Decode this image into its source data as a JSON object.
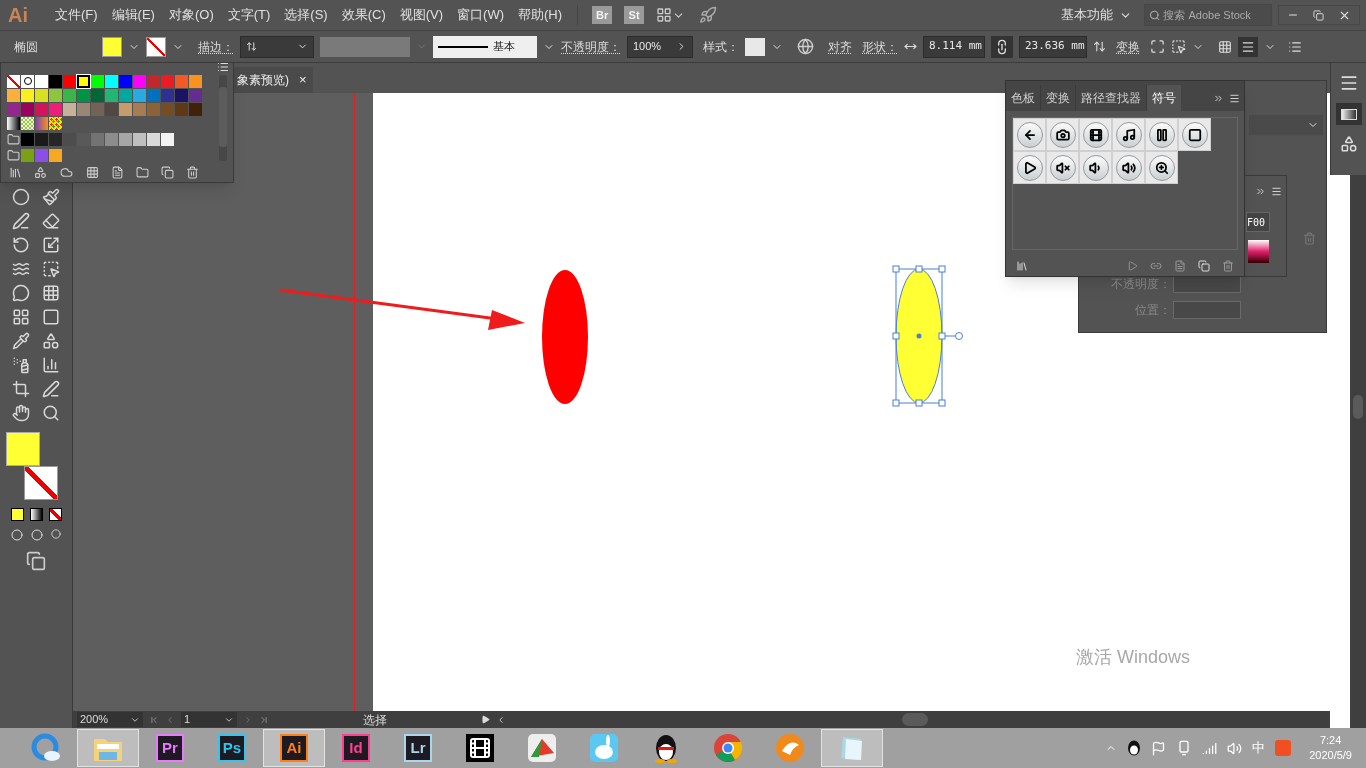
{
  "menu_bar": {
    "logo": "Ai",
    "items": [
      "文件(F)",
      "编辑(E)",
      "对象(O)",
      "文字(T)",
      "选择(S)",
      "效果(C)",
      "视图(V)",
      "窗口(W)",
      "帮助(H)"
    ],
    "bridge": "Br",
    "stock": "St",
    "workspace": "基本功能",
    "search": {
      "placeholder": "搜索 Adobe Stock"
    }
  },
  "control_bar": {
    "object_type": "椭圆",
    "fill": {
      "color": "#ffff33"
    },
    "stroke": {
      "kind": "none"
    },
    "stroke_label": "描边：",
    "profile": "基本",
    "opacity_label": "不透明度：",
    "opacity": "100%",
    "style_label": "样式：",
    "align": "对齐",
    "shape_label": "形状：",
    "width": "8.114 mm",
    "height": "23.636 mm",
    "transform": "变换"
  },
  "document_tab": {
    "title": "象素预览)",
    "close": "×"
  },
  "swatches": {
    "rows": [
      [
        {
          "kind": "none",
          "selected": false
        },
        {
          "kind": "registration",
          "selected": false
        },
        {
          "kind": "color",
          "color": "#ffffff",
          "selected": false
        },
        {
          "kind": "color",
          "color": "#000000",
          "selected": false
        },
        {
          "kind": "color",
          "color": "#ff0000",
          "selected": false
        },
        {
          "kind": "color",
          "color": "#ffff00",
          "selected": true
        },
        {
          "kind": "color",
          "color": "#00ff00",
          "selected": false
        },
        {
          "kind": "color",
          "color": "#00ffff",
          "selected": false
        },
        {
          "kind": "color",
          "color": "#0000ff",
          "selected": false
        },
        {
          "kind": "color",
          "color": "#ff00ff",
          "selected": false
        },
        {
          "kind": "color",
          "color": "#c1272d",
          "selected": false
        },
        {
          "kind": "color",
          "color": "#ed1c24",
          "selected": false
        },
        {
          "kind": "color",
          "color": "#f15a24",
          "selected": false
        },
        {
          "kind": "color",
          "color": "#f7931e",
          "selected": false
        }
      ],
      [
        {
          "kind": "color",
          "color": "#fbb03b",
          "selected": false
        },
        {
          "kind": "color",
          "color": "#fcee21",
          "selected": false
        },
        {
          "kind": "color",
          "color": "#d9e021",
          "selected": false
        },
        {
          "kind": "color",
          "color": "#8cc63f",
          "selected": false
        },
        {
          "kind": "color",
          "color": "#39b54a",
          "selected": false
        },
        {
          "kind": "color",
          "color": "#009245",
          "selected": false
        },
        {
          "kind": "color",
          "color": "#006837",
          "selected": false
        },
        {
          "kind": "color",
          "color": "#22b573",
          "selected": false
        },
        {
          "kind": "color",
          "color": "#00a99d",
          "selected": false
        },
        {
          "kind": "color",
          "color": "#29abe2",
          "selected": false
        },
        {
          "kind": "color",
          "color": "#0071bc",
          "selected": false
        },
        {
          "kind": "color",
          "color": "#2e3192",
          "selected": false
        },
        {
          "kind": "color",
          "color": "#1b1464",
          "selected": false
        },
        {
          "kind": "color",
          "color": "#662d91",
          "selected": false
        }
      ],
      [
        {
          "kind": "color",
          "color": "#93278f",
          "selected": false
        },
        {
          "kind": "color",
          "color": "#9e005d",
          "selected": false
        },
        {
          "kind": "color",
          "color": "#d4145a",
          "selected": false
        },
        {
          "kind": "color",
          "color": "#ed1e79",
          "selected": false
        },
        {
          "kind": "color",
          "color": "#c7b299",
          "selected": false
        },
        {
          "kind": "color",
          "color": "#998675",
          "selected": false
        },
        {
          "kind": "color",
          "color": "#736357",
          "selected": false
        },
        {
          "kind": "color",
          "color": "#534741",
          "selected": false
        },
        {
          "kind": "color",
          "color": "#c69c6d",
          "selected": false
        },
        {
          "kind": "color",
          "color": "#a67c52",
          "selected": false
        },
        {
          "kind": "color",
          "color": "#8c6239",
          "selected": false
        },
        {
          "kind": "color",
          "color": "#754c24",
          "selected": false
        },
        {
          "kind": "color",
          "color": "#603813",
          "selected": false
        },
        {
          "kind": "color",
          "color": "#42210b",
          "selected": false
        }
      ],
      [
        {
          "kind": "gradient",
          "selected": false
        },
        {
          "kind": "pattern",
          "selected": false
        },
        {
          "kind": "gradient-warm",
          "selected": false
        },
        {
          "kind": "pattern-dots",
          "selected": false
        }
      ]
    ],
    "groups": [
      [
        {
          "color": "#000000",
          "selected": false
        },
        {
          "color": "#1a1a1a",
          "selected": false
        },
        {
          "color": "#262626",
          "selected": false
        },
        {
          "color": "#4d4d4d",
          "selected": false
        },
        {
          "color": "#595959",
          "selected": false
        },
        {
          "color": "#737373",
          "selected": false
        },
        {
          "color": "#8c8c8c",
          "selected": false
        },
        {
          "color": "#a6a6a6",
          "selected": false
        },
        {
          "color": "#bfbfbf",
          "selected": false
        },
        {
          "color": "#d9d9d9",
          "selected": false
        },
        {
          "color": "#f2f2f2",
          "selected": false
        }
      ],
      [
        {
          "color": "#7aa116",
          "selected": false
        },
        {
          "color": "#8a4fe6",
          "selected": false
        },
        {
          "color": "#f7a823",
          "selected": false
        }
      ]
    ]
  },
  "toolbar": {
    "fill": {
      "color": "#ffff33"
    },
    "stroke": {
      "kind": "none"
    }
  },
  "canvas": {
    "objects": [
      {
        "kind": "arrow",
        "color": "#ee1c1c"
      },
      {
        "kind": "ellipse",
        "color": "#ff0000",
        "selected": false
      },
      {
        "kind": "ellipse",
        "color": "#ffff33",
        "selected": true
      }
    ],
    "watermark_text": "激活 Windows"
  },
  "symbols_panel": {
    "tabs": [
      {
        "label": "色板",
        "selected": false
      },
      {
        "label": "变换",
        "selected": false
      },
      {
        "label": "路径查找器",
        "selected": false
      },
      {
        "label": "符号",
        "selected": true
      }
    ]
  },
  "gradient_panel": {
    "hex": "F00",
    "opacity_label": "不透明度：",
    "location_label": "位置："
  },
  "status_bar": {
    "zoom": "200%",
    "artboard": "1",
    "tool": "选择"
  },
  "taskbar": {
    "apps": [
      {
        "kind": "browser",
        "active": false
      },
      {
        "kind": "folder",
        "active": true
      },
      {
        "kind": "adobe",
        "label": "Pr",
        "color": "#ea77ff",
        "active": false
      },
      {
        "kind": "adobe",
        "label": "Ps",
        "color": "#31c5f0",
        "active": false
      },
      {
        "kind": "adobe",
        "label": "Ai",
        "color": "#ff7f18",
        "active": true
      },
      {
        "kind": "adobe",
        "label": "Id",
        "color": "#ff3f94",
        "active": false
      },
      {
        "kind": "adobe",
        "label": "Lr",
        "color": "#a9d5ee",
        "active": false
      },
      {
        "kind": "film",
        "active": false
      },
      {
        "kind": "umbrella",
        "active": false
      },
      {
        "kind": "rabbit",
        "active": false
      },
      {
        "kind": "penguin",
        "active": false
      },
      {
        "kind": "chrome",
        "active": false
      },
      {
        "kind": "orange",
        "active": false
      },
      {
        "kind": "notepad",
        "active": true
      }
    ],
    "ime": "中",
    "time": "7:24",
    "date": "2020/5/9"
  }
}
